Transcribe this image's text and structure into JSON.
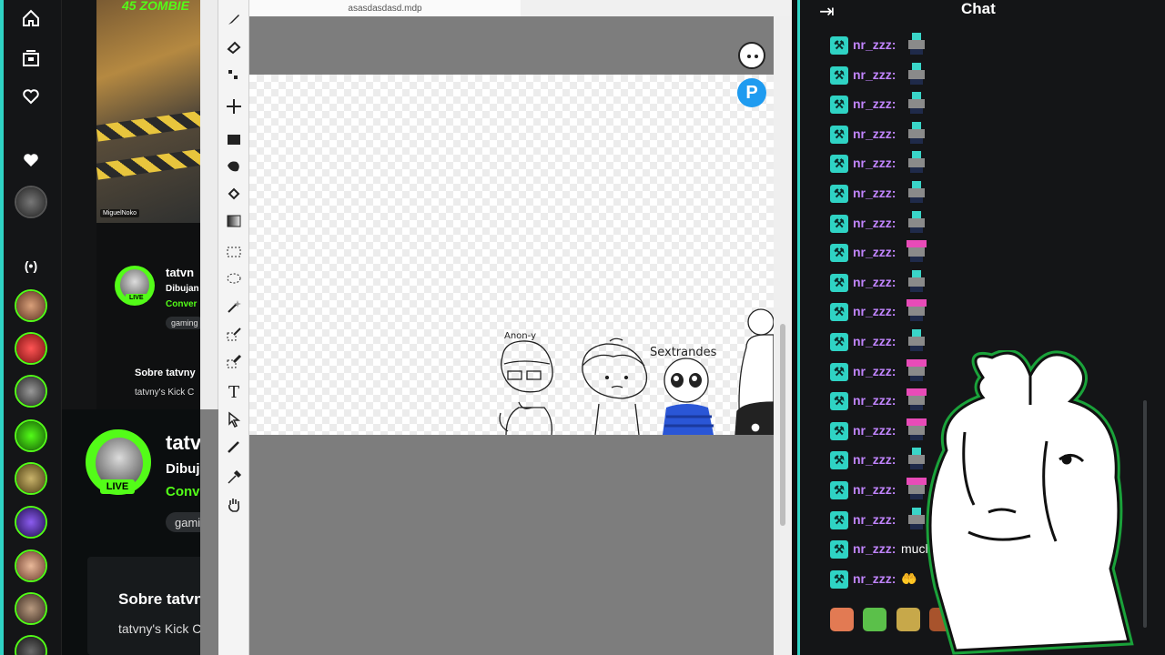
{
  "paint": {
    "filename": "asasdasdasd.mdp",
    "pixiv_label": "P",
    "canvas_labels": {
      "a": "Anon-y",
      "b": "Sextrandes"
    }
  },
  "kick": {
    "channel": {
      "name": "tatvny",
      "title": "Dibujan",
      "category": "Convers",
      "tag": "gaming",
      "live_label": "LIVE",
      "about_title": "Sobre tatvny",
      "about_text": "tatvny's Kick C"
    },
    "mini": {
      "name": "tatvn",
      "title": "Dibujan",
      "category": "Conver",
      "tag": "gaming",
      "live_label": "LIVE",
      "about_title": "Sobre tatvny",
      "about_text": "tatvny's Kick C",
      "video_tag": "MiguelNoko"
    },
    "live_icon": "(•)"
  },
  "chat": {
    "title": "Chat",
    "collapse_icon": "⇥",
    "messages": [
      {
        "user": "nr_zzz:",
        "emote": "cube"
      },
      {
        "user": "nr_zzz:",
        "emote": "cube"
      },
      {
        "user": "nr_zzz:",
        "emote": "cube"
      },
      {
        "user": "nr_zzz:",
        "emote": "cube"
      },
      {
        "user": "nr_zzz:",
        "emote": "cube"
      },
      {
        "user": "nr_zzz:",
        "emote": "cube"
      },
      {
        "user": "nr_zzz:",
        "emote": "cube"
      },
      {
        "user": "nr_zzz:",
        "emote": "pink"
      },
      {
        "user": "nr_zzz:",
        "emote": "cube"
      },
      {
        "user": "nr_zzz:",
        "emote": "pink"
      },
      {
        "user": "nr_zzz:",
        "emote": "cube"
      },
      {
        "user": "nr_zzz:",
        "emote": "pink"
      },
      {
        "user": "nr_zzz:",
        "emote": "pink"
      },
      {
        "user": "nr_zzz:",
        "emote": "pink"
      },
      {
        "user": "nr_zzz:",
        "emote": "cube"
      },
      {
        "user": "nr_zzz:",
        "emote": "pink"
      },
      {
        "user": "nr_zzz:",
        "emote": "cube"
      },
      {
        "user": "nr_zzz:",
        "text": "mucho"
      },
      {
        "user": "nr_zzz:",
        "emote": "hands"
      }
    ]
  }
}
